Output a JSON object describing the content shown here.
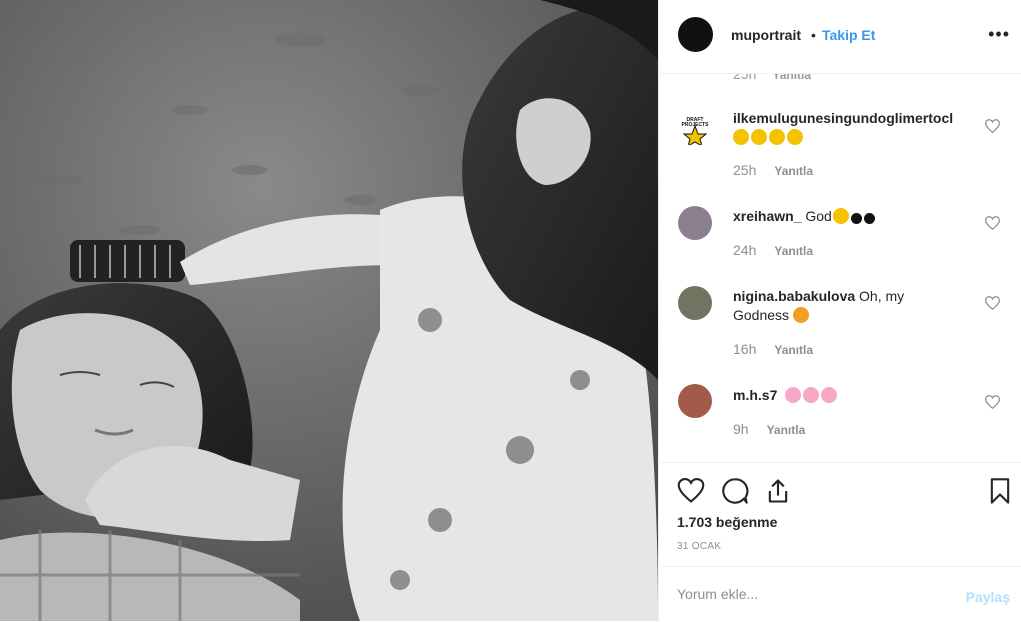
{
  "post": {
    "username": "muportrait",
    "separator": "•",
    "follow_label": "Takip Et",
    "more_label": "•••",
    "photo_icon": "black-and-white-photo-mother-and-child-brushing-hair"
  },
  "partial_comment": {
    "time": "25h",
    "reply_label": "Yanıtla"
  },
  "comments": [
    {
      "username": "ilkemulugunesingundoglimertocl",
      "text": "",
      "emojis": [
        "heart-eyes-emoji",
        "heart-eyes-emoji",
        "heart-eyes-emoji",
        "heart-eyes-emoji"
      ],
      "time": "25h",
      "reply_label": "Yanıtla"
    },
    {
      "username": "xreihawn_",
      "text": "God",
      "emojis": [
        "crying-emoji",
        "black-heart-emoji",
        "black-heart-emoji"
      ],
      "time": "24h",
      "reply_label": "Yanıtla"
    },
    {
      "username": "nigina.babakulova",
      "text": "Oh, my Godness",
      "emojis": [
        "heart-eyes-cat-emoji"
      ],
      "time": "16h",
      "reply_label": "Yanıtla"
    },
    {
      "username": "m.h.s7",
      "text": "",
      "emojis": [
        "cherry-blossom-emoji",
        "cherry-blossom-emoji",
        "cherry-blossom-emoji"
      ],
      "time": "9h",
      "reply_label": "Yanıtla"
    }
  ],
  "actions": {
    "like_icon": "heart-icon",
    "comment_icon": "comment-icon",
    "share_icon": "share-icon",
    "save_icon": "bookmark-icon"
  },
  "likes": "1.703 beğenme",
  "date": "31 OCAK",
  "add_comment": {
    "placeholder": "Yorum ekle...",
    "post_label": "Paylaş"
  },
  "colors": {
    "link": "#3897f0",
    "muted": "#8e8e8e",
    "text": "#262626",
    "post_disabled": "#b2dffc"
  }
}
